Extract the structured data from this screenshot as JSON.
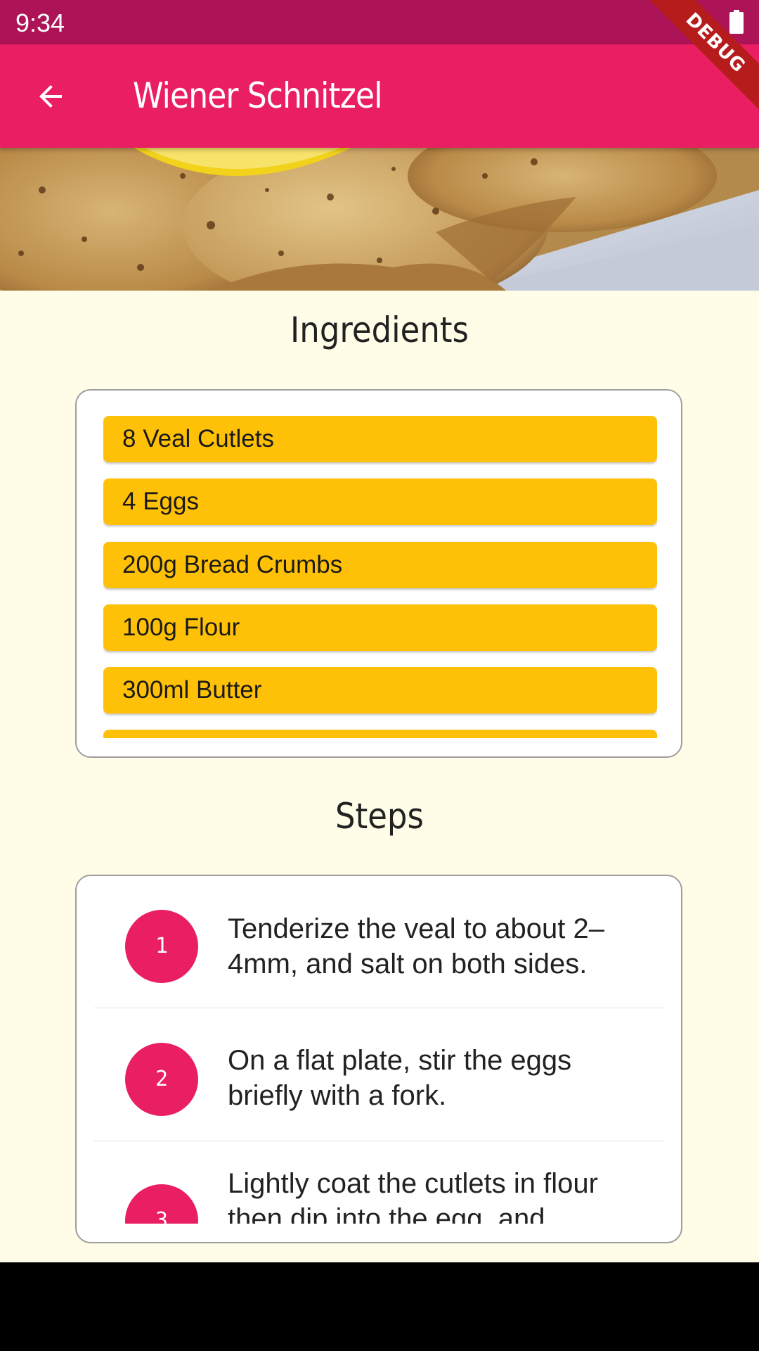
{
  "status_bar": {
    "time": "9:34"
  },
  "app_bar": {
    "title": "Wiener Schnitzel"
  },
  "debug_banner": "DEBUG",
  "ingredients": {
    "title": "Ingredients",
    "items": [
      "8 Veal Cutlets",
      "4 Eggs",
      "200g Bread Crumbs",
      "100g Flour",
      "300ml Butter",
      ""
    ]
  },
  "steps": {
    "title": "Steps",
    "items": [
      {
        "number": "1",
        "text": "Tenderize the veal to about 2–4mm, and salt on both sides."
      },
      {
        "number": "2",
        "text": "On a flat plate, stir the eggs briefly with a fork."
      },
      {
        "number": "3",
        "text": "Lightly coat the cutlets in flour then dip into the egg, and"
      }
    ]
  },
  "colors": {
    "primary": "#E91E63",
    "primary_dark": "#AD1457",
    "ingredient_bg": "#FFC107",
    "page_bg": "#FFFDE7"
  }
}
